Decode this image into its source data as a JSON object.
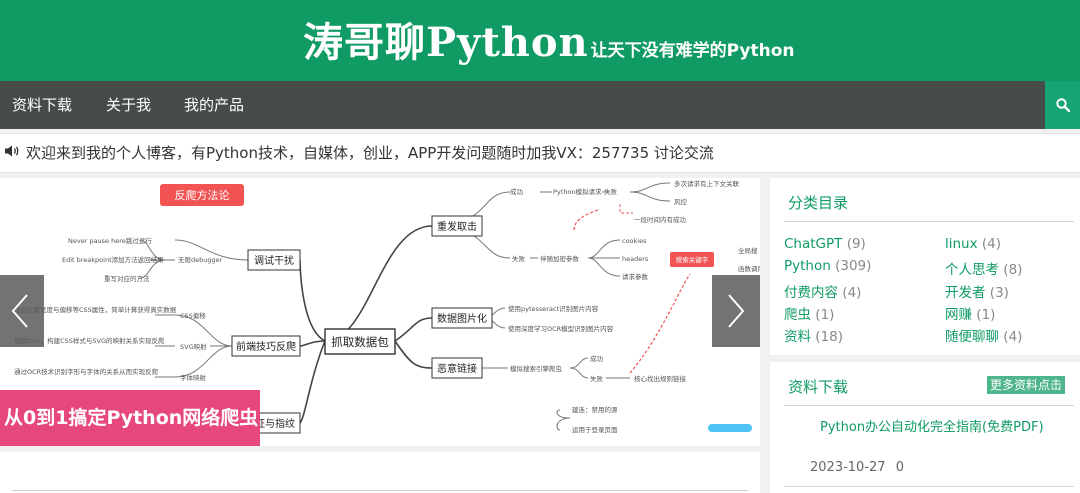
{
  "header": {
    "title": "涛哥聊Python",
    "slogan": "让天下没有难学的Python"
  },
  "nav": {
    "items": [
      {
        "label": "资料下载"
      },
      {
        "label": "关于我"
      },
      {
        "label": "我的产品"
      }
    ],
    "search_icon": "search-icon"
  },
  "notice": {
    "icon": "speaker-icon",
    "text": "欢迎来到我的个人博客，有Python技术，自媒体，创业，APP开发问题随时加我VX：257735 讨论交流"
  },
  "slider": {
    "caption": "从0到1搞定Python网络爬虫",
    "mindmap": {
      "top_badge": "反爬方法论",
      "center": "抓取数据包",
      "branches": [
        "重发取击",
        "调试干扰",
        "数据图片化",
        "前端技巧反爬",
        "恶意链接",
        "证与指纹"
      ],
      "leaves_top_right": [
        "成功",
        "Python模拟请求",
        "失败",
        "多次请求有上下文关联",
        "风控",
        "一段时间内有成功",
        "失败",
        "伴随加密参数",
        "cookies",
        "headers",
        "请求参数",
        "搜索关键字",
        "全局搜",
        "函数调用"
      ],
      "leaves_left": [
        "Never pause here跳过运行",
        "Edit breakpoint添加方法返回结果",
        "重写对应的方法",
        "无限debugger"
      ],
      "leaves_css": [
        "找到元素宽度与偏移等CSS属性，简单计算获得真实数据",
        "CSS偏移",
        "理解SVG，构建CSS样式与SVG的映射关系实现反爬",
        "SVG映射",
        "通过OCR技术识别字形与字体的关系从而实现反爬",
        "字体映射"
      ],
      "leaves_image": [
        "使用pytesseract识别图片内容",
        "使用深度学习OCR模型识别图片内容"
      ],
      "leaves_link": [
        "模拟搜索引擎爬虫",
        "成功",
        "失败",
        "核心找出规则链接"
      ],
      "leaves_bottom": [
        "建连：禁用的源",
        "运用于登录页面"
      ]
    }
  },
  "sidebar": {
    "categories": {
      "title": "分类目录",
      "items": [
        {
          "name": "ChatGPT",
          "count": "(9)"
        },
        {
          "name": "linux",
          "count": "(4)"
        },
        {
          "name": "Python",
          "count": "(309)"
        },
        {
          "name": "个人思考",
          "count": "(8)"
        },
        {
          "name": "付费内容",
          "count": "(4)"
        },
        {
          "name": "开发者",
          "count": "(3)"
        },
        {
          "name": "爬虫",
          "count": "(1)"
        },
        {
          "name": "网赚",
          "count": "(1)"
        },
        {
          "name": "资料",
          "count": "(18)"
        },
        {
          "name": "随便聊聊",
          "count": "(4)"
        }
      ]
    },
    "downloads": {
      "title": "资料下载",
      "more_label": "更多资料点击",
      "item_title": "Python办公自动化完全指南(免费PDF)",
      "item_date": "2023-10-27",
      "item_count": "0"
    }
  },
  "colors": {
    "brand_green": "#0f9b63",
    "nav_bg": "#464c48",
    "caption_pink": "#e6477e",
    "badge_red": "#f25454"
  }
}
